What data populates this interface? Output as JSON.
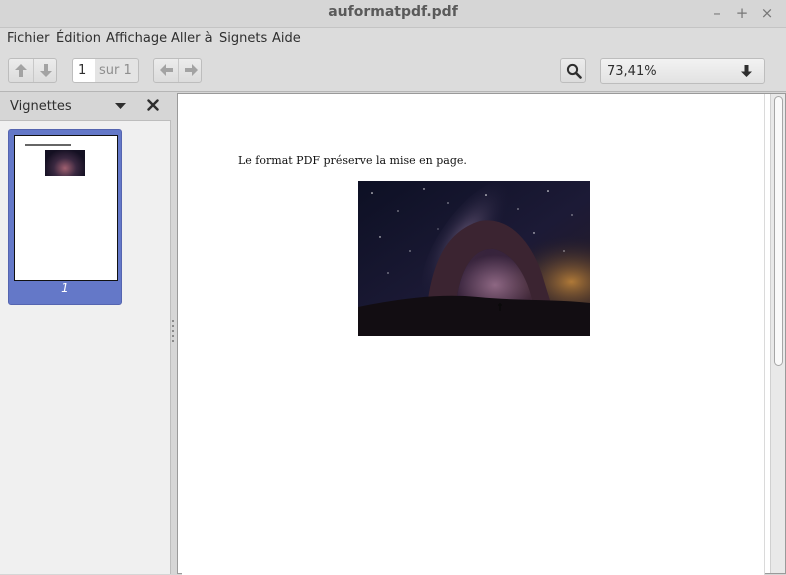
{
  "window": {
    "title": "auformatpdf.pdf",
    "minimize_symbol": "–",
    "maximize_symbol": "+",
    "close_symbol": "×"
  },
  "menubar": {
    "items": [
      "Fichier",
      "Édition",
      "Affichage",
      "Aller à",
      "Signets",
      "Aide"
    ]
  },
  "toolbar": {
    "page_nav_icons": [
      "arrow-up-icon",
      "arrow-down-icon"
    ],
    "history_icons": [
      "arrow-left-icon",
      "arrow-right-icon"
    ],
    "page_number_value": "1",
    "page_of_text": "sur 1",
    "search_icon": "search-icon",
    "zoom_value": "73,41%",
    "zoom_dropdown_icon": "arrow-down-icon"
  },
  "sidebar": {
    "title": "Vignettes",
    "dropdown_icon": "triangle-down-icon",
    "close_icon": "close-icon",
    "thumbnails": [
      {
        "label": "1",
        "selected": true
      }
    ],
    "selected_color": "#6478c8"
  },
  "document": {
    "text": "Le format PDF préserve la mise en page.",
    "image": {
      "description_icon": "photo-night-arch",
      "kind": "photo"
    }
  }
}
